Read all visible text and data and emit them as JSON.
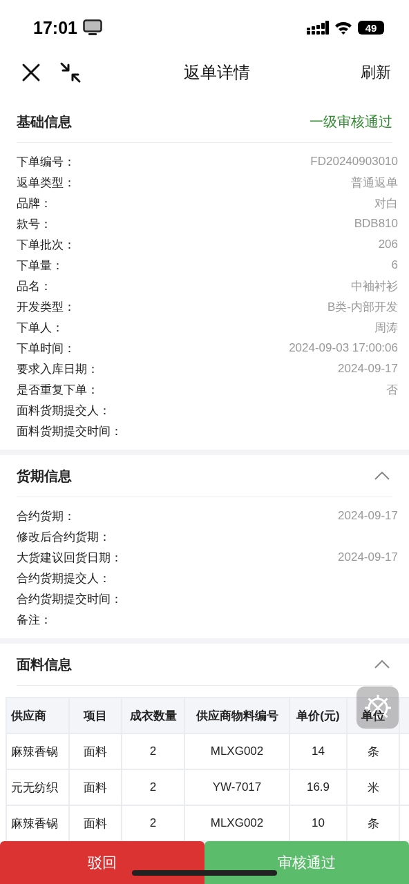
{
  "status_bar": {
    "time": "17:01",
    "battery": "49"
  },
  "nav": {
    "title": "返单详情",
    "action": "刷新"
  },
  "sections": [
    {
      "title": "基础信息",
      "status": "一级审核通过",
      "fields": [
        {
          "label": "下单编号：",
          "value": "FD20240903010"
        },
        {
          "label": "返单类型：",
          "value": "普通返单"
        },
        {
          "label": "品牌：",
          "value": "对白"
        },
        {
          "label": "款号：",
          "value": "BDB810"
        },
        {
          "label": "下单批次：",
          "value": "206"
        },
        {
          "label": "下单量：",
          "value": "6"
        },
        {
          "label": "品名：",
          "value": "中袖衬衫"
        },
        {
          "label": "开发类型：",
          "value": "B类-内部开发"
        },
        {
          "label": "下单人：",
          "value": "周涛"
        },
        {
          "label": "下单时间：",
          "value": "2024-09-03 17:00:06"
        },
        {
          "label": "要求入库日期：",
          "value": "2024-09-17"
        },
        {
          "label": "是否重复下单：",
          "value": "否"
        },
        {
          "label": "面料货期提交人："
        },
        {
          "label": "面料货期提交时间："
        }
      ]
    },
    {
      "title": "货期信息",
      "expanded": true,
      "fields": [
        {
          "label": "合约货期：",
          "value": "2024-09-17"
        },
        {
          "label": "修改后合约货期："
        },
        {
          "label": "大货建议回货日期：",
          "value": "2024-09-17"
        },
        {
          "label": "合约货期提交人："
        },
        {
          "label": "合约货期提交时间："
        },
        {
          "label": "备注："
        }
      ]
    },
    {
      "title": "面料信息",
      "expanded": true,
      "table": {
        "columns": [
          "供应商",
          "项目",
          "成衣数量",
          "供应商物料编号",
          "单价(元)",
          "单位"
        ],
        "rows": [
          [
            "麻辣香锅",
            "面料",
            "2",
            "MLXG002",
            "14",
            "条"
          ],
          [
            "元无纺织",
            "面料",
            "2",
            "YW-7017",
            "16.9",
            "米"
          ],
          [
            "麻辣香锅",
            "面料",
            "2",
            "MLXG002",
            "10",
            "条"
          ]
        ]
      }
    }
  ],
  "buttons": [
    {
      "label": "驳回",
      "kind": "reject"
    },
    {
      "label": "审核通过",
      "kind": "approve"
    }
  ]
}
